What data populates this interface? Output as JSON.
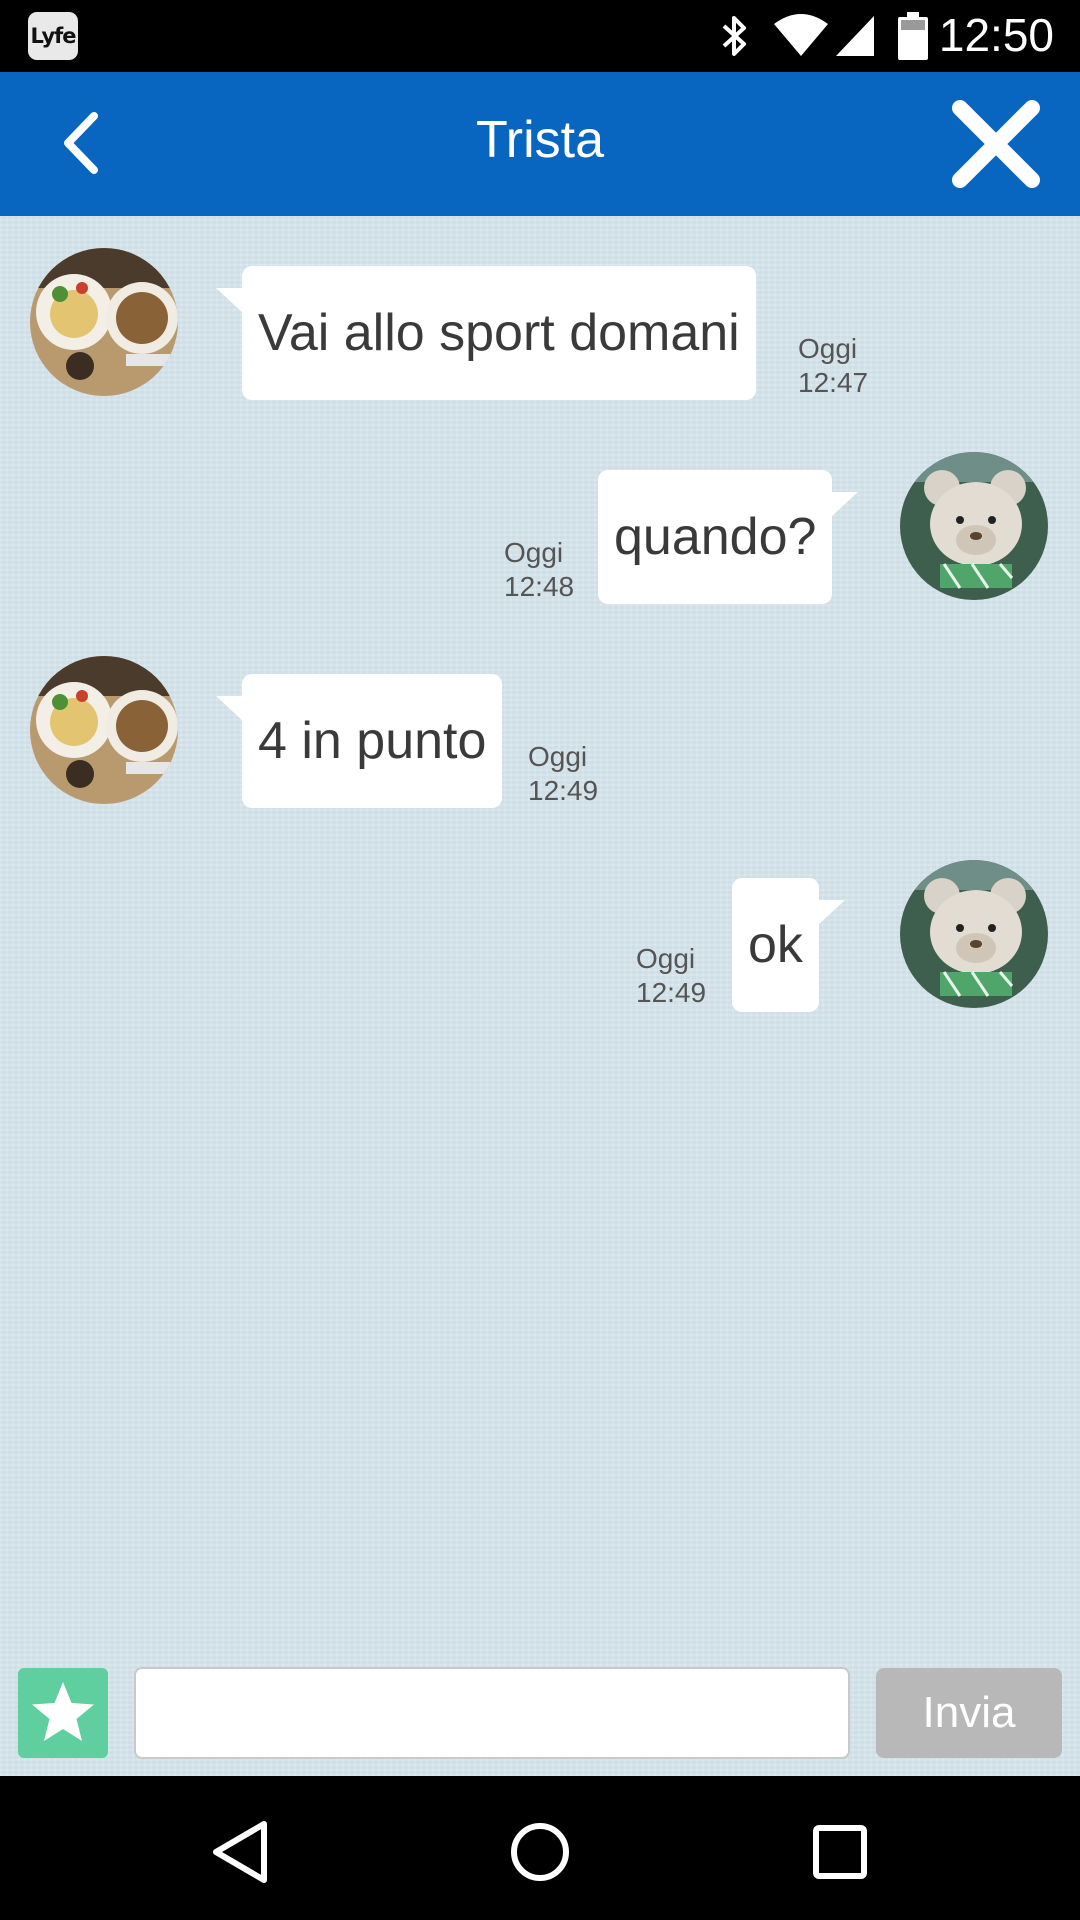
{
  "status_bar": {
    "app_badge": "Lyfe",
    "time": "12:50",
    "icons": [
      "bluetooth-icon",
      "wifi-icon",
      "signal-icon",
      "battery-icon"
    ]
  },
  "header": {
    "title": "Trista",
    "back_icon": "chevron-left-icon",
    "close_icon": "close-icon"
  },
  "messages": [
    {
      "direction": "incoming",
      "text": "Vai allo sport domani",
      "day": "Oggi",
      "time": "12:47"
    },
    {
      "direction": "outgoing",
      "text": "quando?",
      "day": "Oggi",
      "time": "12:48"
    },
    {
      "direction": "incoming",
      "text": "4 in punto",
      "day": "Oggi",
      "time": "12:49"
    },
    {
      "direction": "outgoing",
      "text": "ok",
      "day": "Oggi",
      "time": "12:49"
    }
  ],
  "composer": {
    "value": "",
    "send_label": "Invia",
    "star_icon": "star-icon"
  },
  "colors": {
    "app_bar": "#0966c0",
    "chat_background": "#d4e3ec",
    "star_button": "#5fcf9f",
    "send_button_disabled": "#b8b8b8"
  },
  "nav_bar": [
    "back-triangle-icon",
    "home-circle-icon",
    "recents-square-icon"
  ]
}
